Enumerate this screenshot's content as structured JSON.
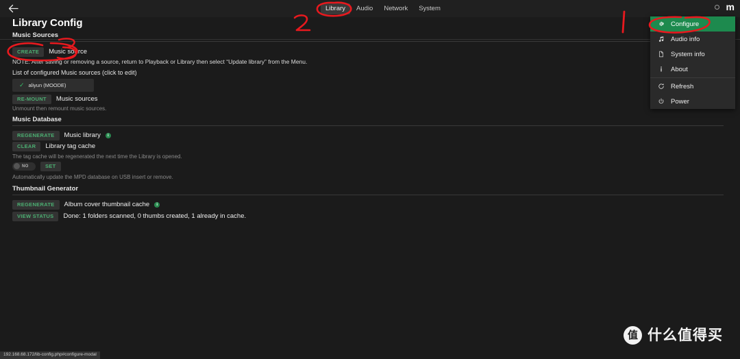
{
  "window": {
    "back_icon": "back-arrow-icon",
    "status_indicator": "loading-circle-icon",
    "brand": "m"
  },
  "tabs": [
    {
      "label": "Library",
      "active": true
    },
    {
      "label": "Audio",
      "active": false
    },
    {
      "label": "Network",
      "active": false
    },
    {
      "label": "System",
      "active": false
    }
  ],
  "page": {
    "title": "Library Config"
  },
  "music_sources": {
    "heading": "Music Sources",
    "create_button": "CREATE",
    "create_label": "Music source",
    "note": "NOTE: After saving or removing a source, return to Playback or Library then select “Update library” from the Menu.",
    "list_label": "List of configured Music sources (click to edit)",
    "items": [
      {
        "name": "aliyun (MOODE)",
        "checked": true
      }
    ],
    "remount_button": "RE-MOUNT",
    "remount_label": "Music sources",
    "remount_help": "Unmount then remount music sources."
  },
  "music_database": {
    "heading": "Music Database",
    "regenerate_button": "REGENERATE",
    "regenerate_label": "Music library",
    "regenerate_info_icon": "info-badge-icon",
    "clear_button": "CLEAR",
    "clear_label": "Library tag cache",
    "clear_help": "The tag cache will be regenerated the next time the Library is opened.",
    "toggle_value": "NO",
    "set_button": "SET",
    "toggle_help": "Automatically update the MPD database on USB insert or remove."
  },
  "thumbnail_generator": {
    "heading": "Thumbnail Generator",
    "regenerate_button": "REGENERATE",
    "regenerate_label": "Album cover thumbnail cache",
    "regenerate_info_icon": "info-badge-icon",
    "view_status_button": "VIEW STATUS",
    "status_text": "Done: 1 folders scanned, 0 thumbs created, 1 already in cache."
  },
  "menu": {
    "items": [
      {
        "label": "Configure",
        "icon": "gear-icon",
        "highlight": true
      },
      {
        "label": "Audio info",
        "icon": "music-note-icon",
        "highlight": false
      },
      {
        "label": "System info",
        "icon": "document-icon",
        "highlight": false
      },
      {
        "label": "About",
        "icon": "info-icon",
        "highlight": false
      },
      {
        "label": "Refresh",
        "icon": "refresh-icon",
        "highlight": false
      },
      {
        "label": "Power",
        "icon": "power-icon",
        "highlight": false
      }
    ]
  },
  "annotations": [
    {
      "id": "marker-1",
      "text": "1"
    },
    {
      "id": "marker-2",
      "text": "2"
    }
  ],
  "watermark": {
    "logo_text": "值",
    "text": "什么值得买"
  },
  "status_bar": {
    "url": "192.168.68.172/lib-config.php#configure-modal"
  },
  "colors": {
    "accent_green": "#1d8a4e",
    "button_green_text": "#4caf72",
    "background": "#1b1b1b",
    "topbar": "#202020",
    "annotation_red": "#e8191e"
  }
}
